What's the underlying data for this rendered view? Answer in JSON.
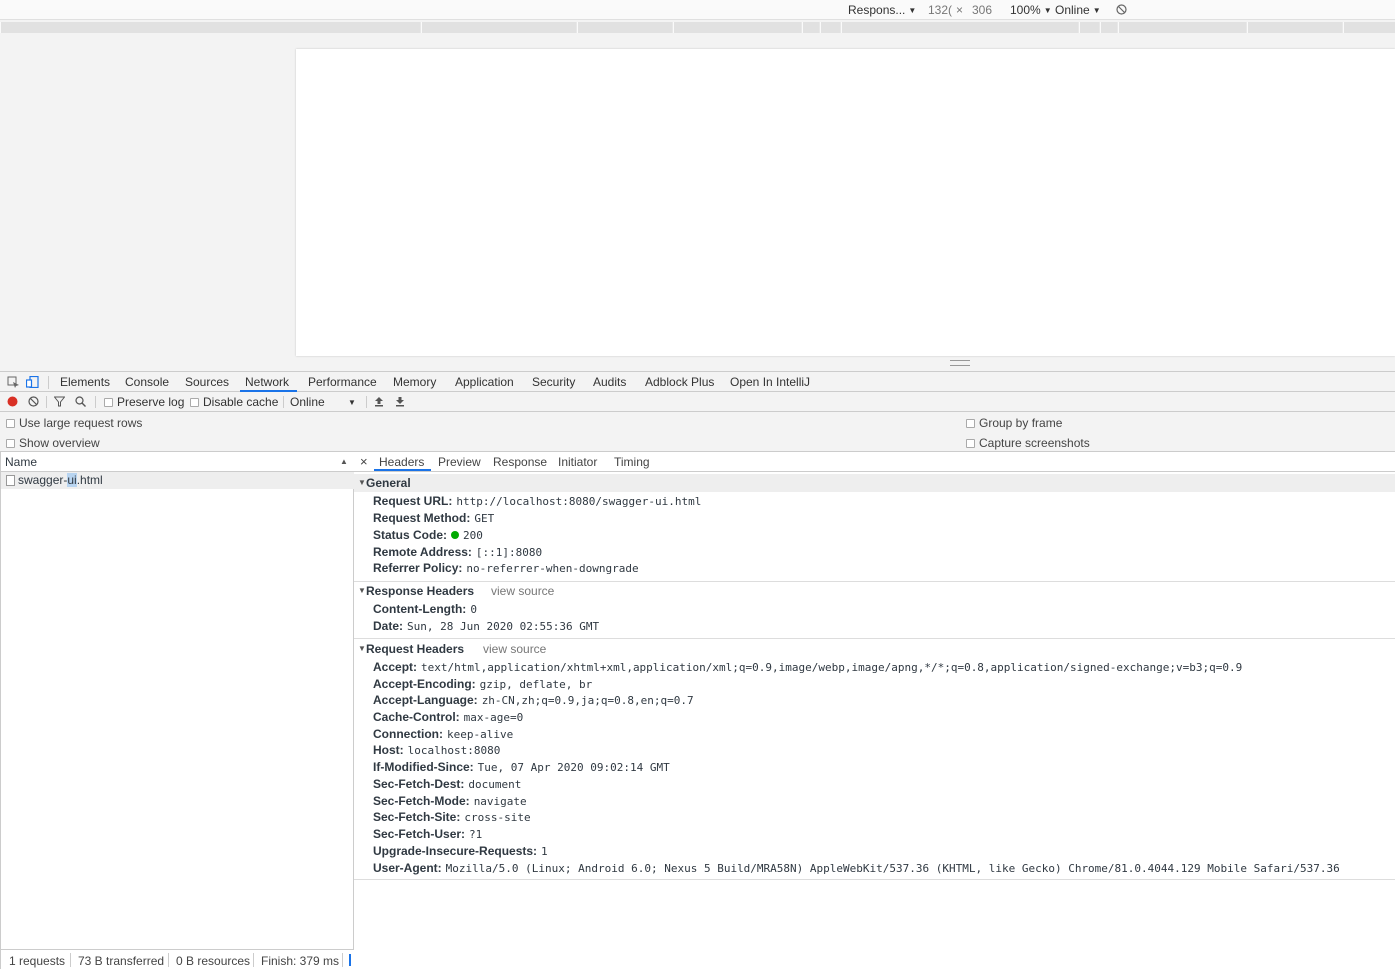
{
  "device_toolbar": {
    "device": "Respons...",
    "width": "132(",
    "times": "×",
    "height": "306",
    "zoom": "100%",
    "throttle": "Online"
  },
  "main_tabs": [
    "Elements",
    "Console",
    "Sources",
    "Network",
    "Performance",
    "Memory",
    "Application",
    "Security",
    "Audits",
    "Adblock Plus",
    "Open In IntelliJ"
  ],
  "active_tab": "Network",
  "net_toolbar": {
    "preserve_log": "Preserve log",
    "disable_cache": "Disable cache",
    "throttle": "Online"
  },
  "options": {
    "large_rows": "Use large request rows",
    "show_overview": "Show overview",
    "group_by_frame": "Group by frame",
    "capture_screenshots": "Capture screenshots"
  },
  "request_list": {
    "header": "Name",
    "items": [
      {
        "name_pre": "swagger-",
        "name_hl": "ui",
        "name_post": ".html"
      }
    ]
  },
  "status_bar": {
    "requests": "1 requests",
    "transferred": "73 B transferred",
    "resources": "0 B resources",
    "finish": "Finish: 379 ms"
  },
  "detail_tabs": [
    "Headers",
    "Preview",
    "Response",
    "Initiator",
    "Timing"
  ],
  "active_detail_tab": "Headers",
  "close_glyph": "×",
  "general": {
    "title": "General",
    "rows": [
      {
        "k": "Request URL:",
        "v": "http://localhost:8080/swagger-ui.html"
      },
      {
        "k": "Request Method:",
        "v": "GET"
      },
      {
        "k": "Status Code:",
        "v": "200"
      },
      {
        "k": "Remote Address:",
        "v": "[::1]:8080"
      },
      {
        "k": "Referrer Policy:",
        "v": "no-referrer-when-downgrade"
      }
    ]
  },
  "response_headers": {
    "title": "Response Headers",
    "view_source": "view source",
    "rows": [
      {
        "k": "Content-Length:",
        "v": "0"
      },
      {
        "k": "Date:",
        "v": "Sun, 28 Jun 2020 02:55:36 GMT"
      }
    ]
  },
  "request_headers": {
    "title": "Request Headers",
    "view_source": "view source",
    "rows": [
      {
        "k": "Accept:",
        "v": "text/html,application/xhtml+xml,application/xml;q=0.9,image/webp,image/apng,*/*;q=0.8,application/signed-exchange;v=b3;q=0.9"
      },
      {
        "k": "Accept-Encoding:",
        "v": "gzip, deflate, br"
      },
      {
        "k": "Accept-Language:",
        "v": "zh-CN,zh;q=0.9,ja;q=0.8,en;q=0.7"
      },
      {
        "k": "Cache-Control:",
        "v": "max-age=0"
      },
      {
        "k": "Connection:",
        "v": "keep-alive"
      },
      {
        "k": "Host:",
        "v": "localhost:8080"
      },
      {
        "k": "If-Modified-Since:",
        "v": "Tue, 07 Apr 2020 09:02:14 GMT"
      },
      {
        "k": "Sec-Fetch-Dest:",
        "v": "document"
      },
      {
        "k": "Sec-Fetch-Mode:",
        "v": "navigate"
      },
      {
        "k": "Sec-Fetch-Site:",
        "v": "cross-site"
      },
      {
        "k": "Sec-Fetch-User:",
        "v": "?1"
      },
      {
        "k": "Upgrade-Insecure-Requests:",
        "v": "1"
      },
      {
        "k": "User-Agent:",
        "v": "Mozilla/5.0 (Linux; Android 6.0; Nexus 5 Build/MRA58N) AppleWebKit/537.36 (KHTML, like Gecko) Chrome/81.0.4044.129 Mobile Safari/537.36"
      }
    ]
  },
  "colors": {
    "accent": "#1a73e8",
    "record": "#d93025",
    "status_ok": "#00aa00"
  }
}
